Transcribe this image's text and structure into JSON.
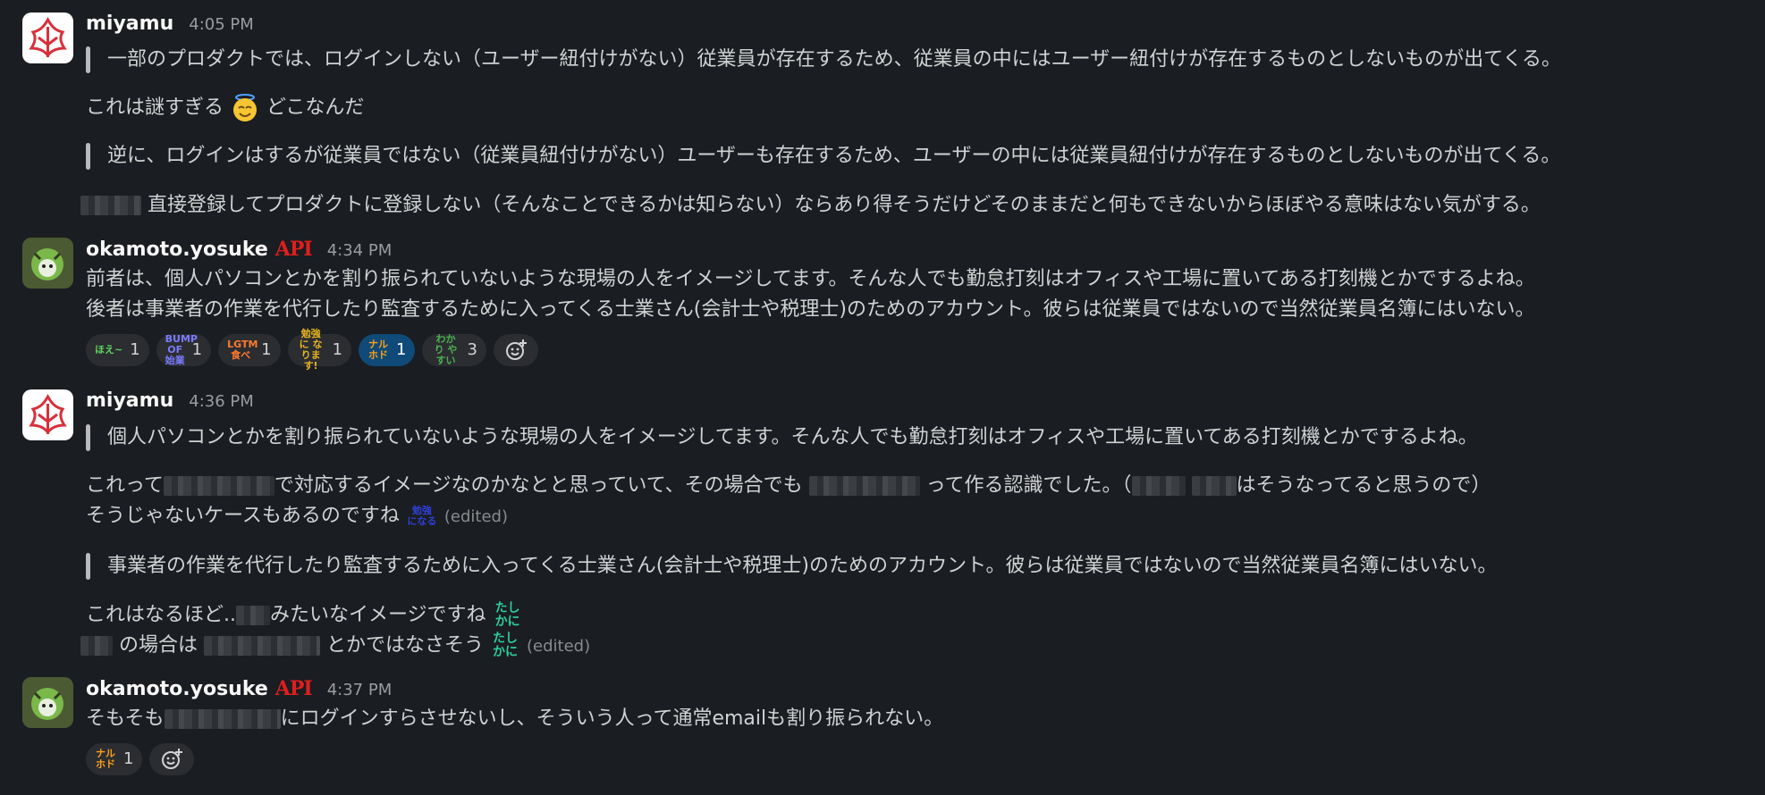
{
  "messages": [
    {
      "author": "miyamu",
      "time": "4:05 PM",
      "quote1": "一部のプロダクトでは、ログインしない（ユーザー紐付けがない）従業員が存在するため、従業員の中にはユーザー紐付けが存在するものとしないものが出てくる。",
      "line1_a": "これは謎すぎる",
      "line1_b": "どこなんだ",
      "quote2": "逆に、ログインはするが従業員ではない（従業員紐付けがない）ユーザーも存在するため、ユーザーの中には従業員紐付けが存在するものとしないものが出てくる。",
      "line2": "直接登録してプロダクトに登録しない（そんなことできるかは知らない）ならあり得そうだけどそのままだと何もできないからほぼやる意味はない気がする。"
    },
    {
      "author": "okamoto.yosuke",
      "badge": "API",
      "time": "4:34 PM",
      "line1": "前者は、個人パソコンとかを割り振られていないような現場の人をイメージしてます。そんな人でも勤怠打刻はオフィスや工場に置いてある打刻機とかでするよね。",
      "line2": "後者は事業者の作業を代行したり監査するために入ってくる士業さん(会計士や税理士)のためのアカウント。彼らは従業員ではないので当然従業員名簿にはいない。",
      "reactions": [
        {
          "stamp": "ほえ~",
          "color": "#5fd35f",
          "count": "1"
        },
        {
          "stamp": "BUMP OF 始業",
          "color": "#7b7bff",
          "count": "1"
        },
        {
          "stamp": "LGTM 食べ",
          "color": "#ff7a2e",
          "count": "1"
        },
        {
          "stamp": "勉強に なります!",
          "color": "#e6b422",
          "count": "1"
        },
        {
          "stamp": "ナル ホド",
          "color": "#ff9f1a",
          "count": "1",
          "active": true
        },
        {
          "stamp": "わかり やすい",
          "color": "#4caf50",
          "count": "3"
        }
      ]
    },
    {
      "author": "miyamu",
      "time": "4:36 PM",
      "quote1": "個人パソコンとかを割り振られていないような現場の人をイメージしてます。そんな人でも勤怠打刻はオフィスや工場に置いてある打刻機とかでするよね。",
      "l1_a": "これって",
      "l1_b": "で対応するイメージなのかなとと思っていて、その場合でも",
      "l1_c": "って作る認識でした。（",
      "l1_d": "はそうなってると思うので）",
      "l2": "そうじゃないケースもあるのですね",
      "l2_stamp": "勉強 になる",
      "edited": "(edited)",
      "quote2": "事業者の作業を代行したり監査するために入ってくる士業さん(会計士や税理士)のためのアカウント。彼らは従業員ではないので当然従業員名簿にはいない。",
      "l3_a": "これはなるほど..",
      "l3_b": "みたいなイメージですね",
      "stamp_tashika": "たし かに",
      "l4_a": "の場合は",
      "l4_b": "とかではなさそう"
    },
    {
      "author": "okamoto.yosuke",
      "badge": "API",
      "time": "4:37 PM",
      "l1_a": "そもそも",
      "l1_b": "にログインすらさせないし、そういう人って通常emailも割り振られない。",
      "reactions": [
        {
          "stamp": "ナル ホド",
          "color": "#ff9f1a",
          "count": "1"
        }
      ]
    }
  ],
  "icons": {
    "add_reaction": "add-reaction-icon",
    "smile_halo": "smiling-face-with-halo-icon"
  }
}
